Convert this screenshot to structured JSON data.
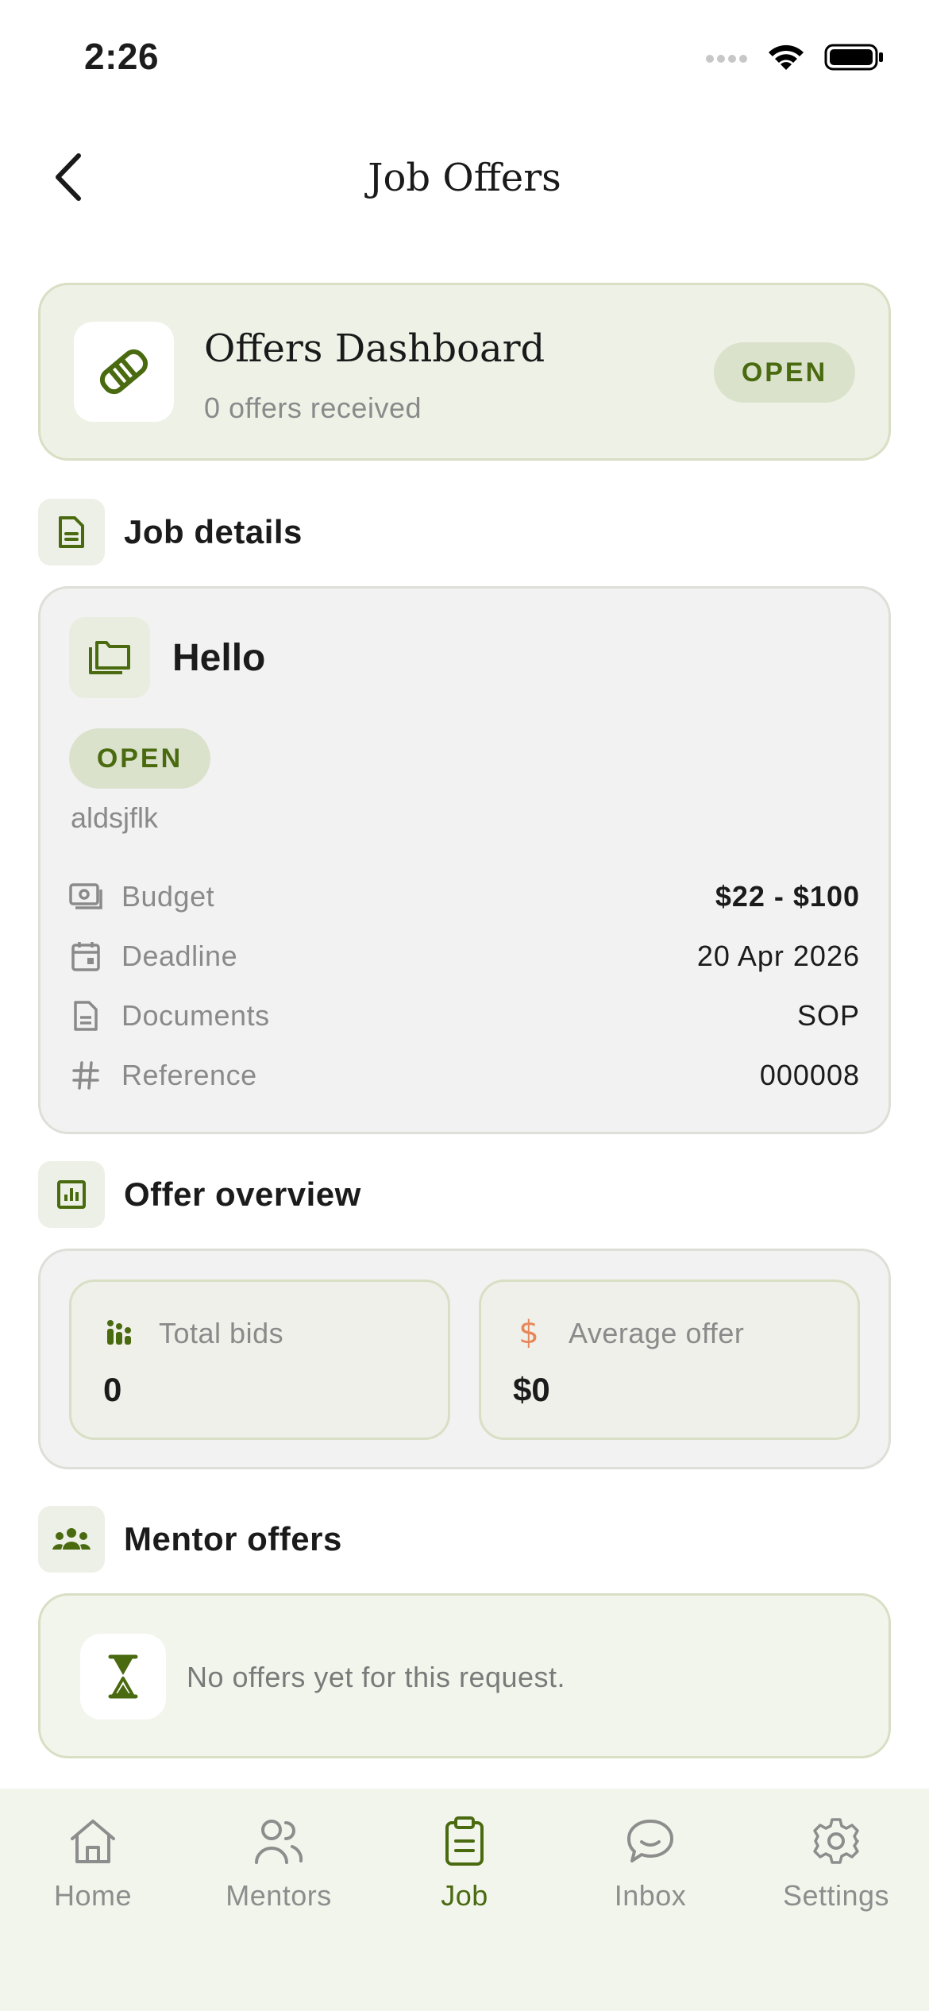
{
  "status_bar": {
    "time": "2:26"
  },
  "header": {
    "title": "Job Offers"
  },
  "dashboard": {
    "title": "Offers Dashboard",
    "subtitle": "0 offers received",
    "status": "OPEN"
  },
  "job_details": {
    "section_title": "Job details",
    "title": "Hello",
    "status": "OPEN",
    "description": "aldsjflk",
    "rows": [
      {
        "icon": "money-icon",
        "label": "Budget",
        "value": "$22 - $100"
      },
      {
        "icon": "calendar-icon",
        "label": "Deadline",
        "value": "20 Apr 2026"
      },
      {
        "icon": "document-icon",
        "label": "Documents",
        "value": "SOP"
      },
      {
        "icon": "hash-icon",
        "label": "Reference",
        "value": "000008"
      }
    ]
  },
  "offer_overview": {
    "section_title": "Offer overview",
    "total_bids_label": "Total bids",
    "total_bids_value": "0",
    "average_offer_label": "Average offer",
    "average_offer_value": "$0"
  },
  "mentor_offers": {
    "section_title": "Mentor offers",
    "empty_text": "No offers yet for this request."
  },
  "tabs": [
    {
      "label": "Home",
      "icon": "home-icon"
    },
    {
      "label": "Mentors",
      "icon": "people-icon"
    },
    {
      "label": "Job",
      "icon": "clipboard-icon",
      "active": true
    },
    {
      "label": "Inbox",
      "icon": "chat-icon"
    },
    {
      "label": "Settings",
      "icon": "gear-icon"
    }
  ],
  "colors": {
    "accent": "#4a6a10",
    "card_green": "#eef1e6",
    "pill_bg": "#dbe2cc",
    "dollar_orange": "#e8875a"
  }
}
